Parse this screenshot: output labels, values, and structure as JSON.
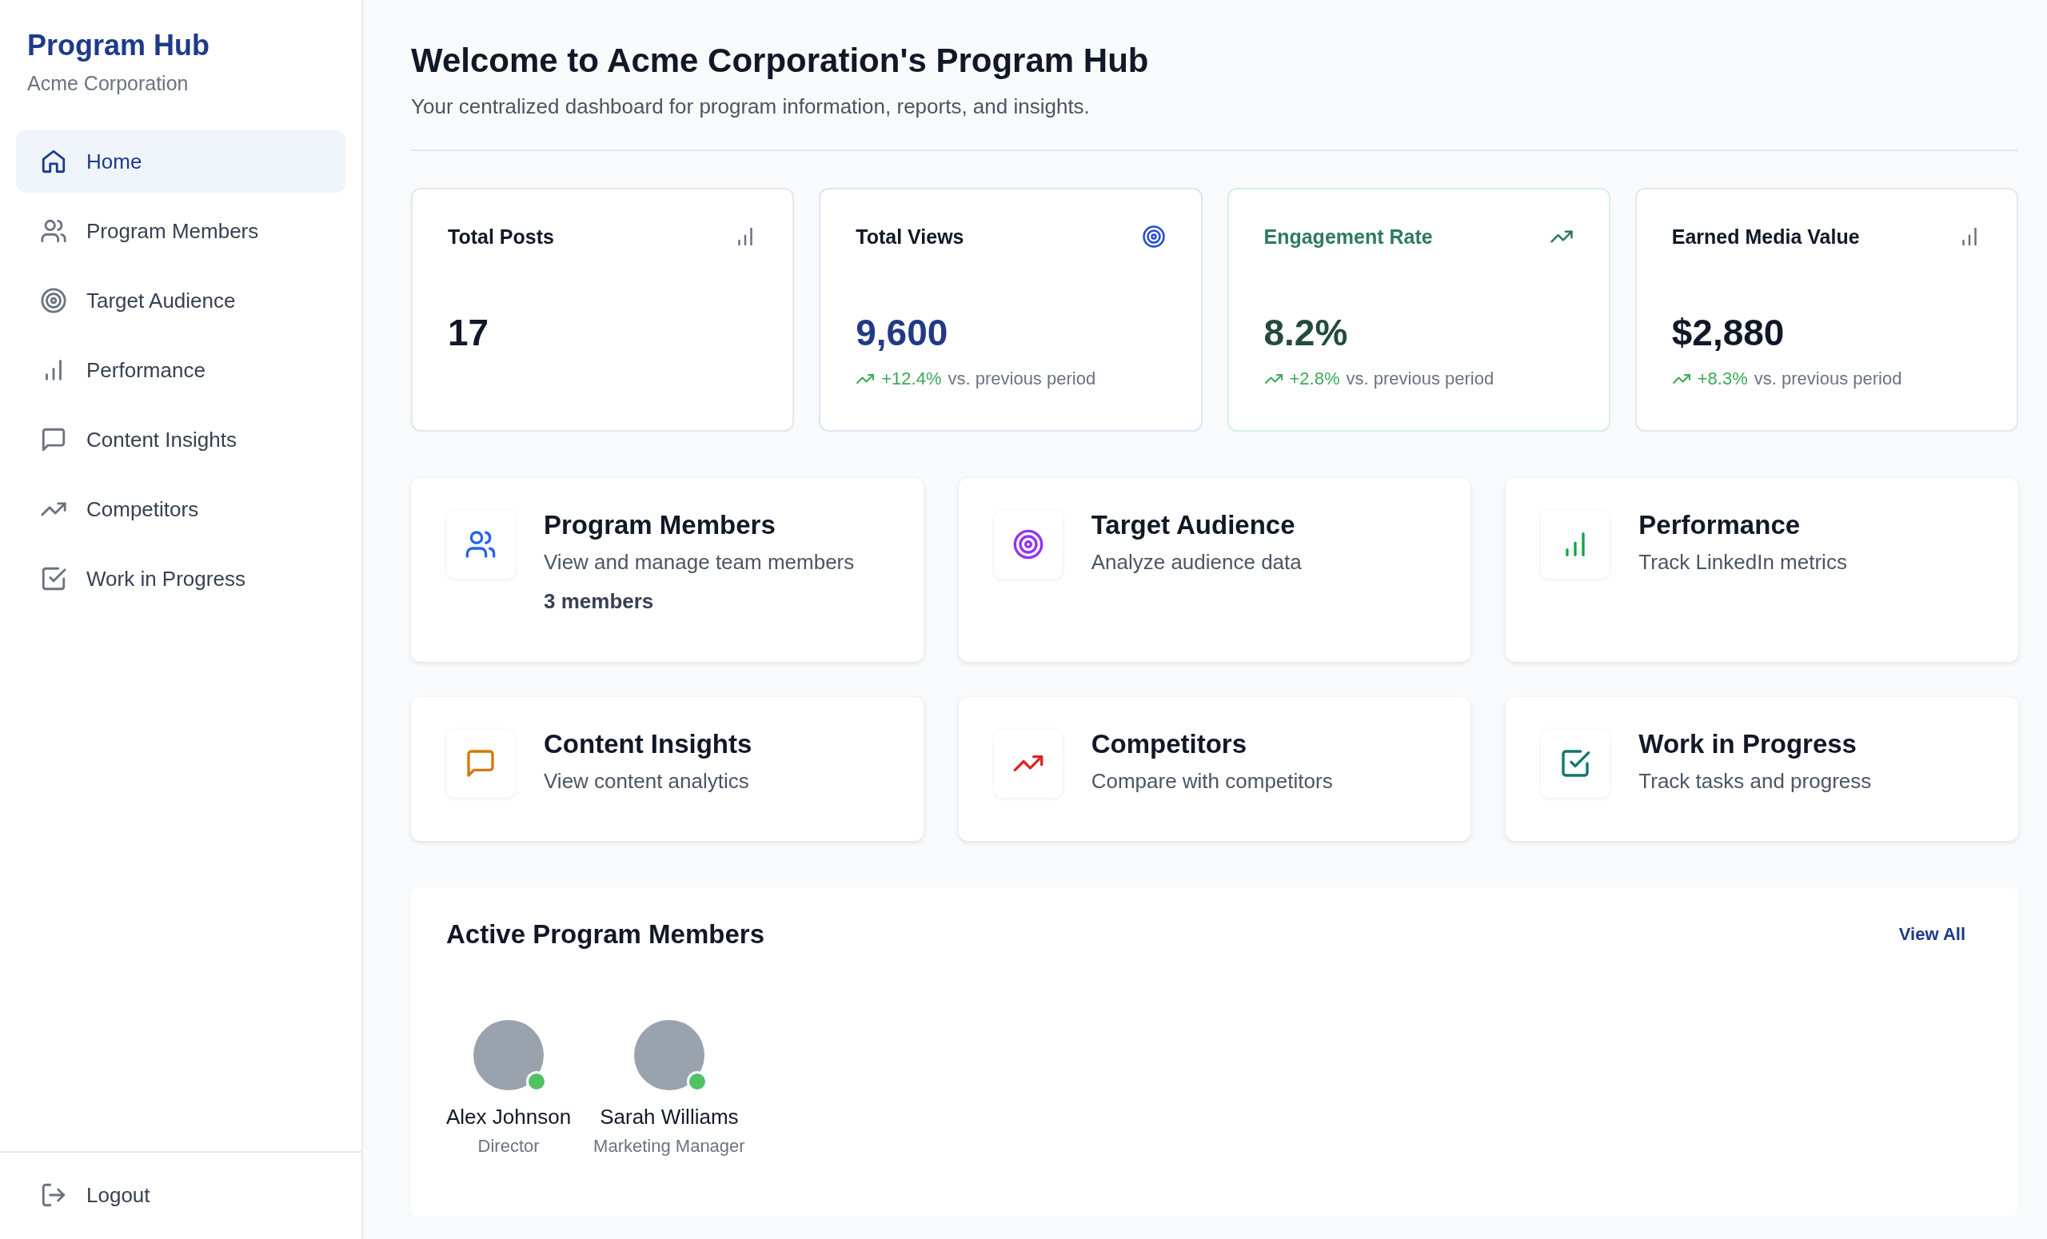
{
  "sidebar": {
    "title": "Program Hub",
    "subtitle": "Acme Corporation",
    "items": [
      {
        "label": "Home",
        "kind": "home",
        "selected": true
      },
      {
        "label": "Program Members",
        "kind": "members",
        "selected": false
      },
      {
        "label": "Target Audience",
        "kind": "target",
        "selected": false
      },
      {
        "label": "Performance",
        "kind": "performance",
        "selected": false
      },
      {
        "label": "Content Insights",
        "kind": "content",
        "selected": false
      },
      {
        "label": "Competitors",
        "kind": "competitors",
        "selected": false
      },
      {
        "label": "Work in Progress",
        "kind": "tasks",
        "selected": false
      }
    ],
    "logout": "Logout"
  },
  "header": {
    "title": "Welcome to Acme Corporation's Program Hub",
    "subtitle": "Your centralized dashboard for program information, reports, and insights."
  },
  "stats": [
    {
      "title": "Total Posts",
      "value": "17",
      "kind": "plain"
    },
    {
      "title": "Total Views",
      "value": "9,600",
      "kind": "primary",
      "change": "+12.4%",
      "change_note": "vs. previous period"
    },
    {
      "title": "Engagement Rate",
      "value": "8.2%",
      "kind": "success",
      "change": "+2.8%",
      "change_note": "vs. previous period"
    },
    {
      "title": "Earned Media Value",
      "value": "$2,880",
      "kind": "plain",
      "change": "+8.3%",
      "change_note": "vs. previous period"
    }
  ],
  "features": [
    {
      "title": "Program Members",
      "description": "View and manage team members",
      "count": "3 members",
      "kind": "members",
      "color": "#2563eb"
    },
    {
      "title": "Target Audience",
      "description": "Analyze audience data",
      "kind": "target",
      "color": "#9333ea"
    },
    {
      "title": "Performance",
      "description": "Track LinkedIn metrics",
      "kind": "performance",
      "color": "#16a34a"
    },
    {
      "title": "Content Insights",
      "description": "View content analytics",
      "kind": "content",
      "color": "#d97706"
    },
    {
      "title": "Competitors",
      "description": "Compare with competitors",
      "kind": "competitors",
      "color": "#dc2626"
    },
    {
      "title": "Work in Progress",
      "description": "Track tasks and progress",
      "kind": "tasks",
      "color": "#0f766e"
    }
  ],
  "members_section": {
    "title": "Active Program Members",
    "link": "View All",
    "members": [
      {
        "name": "Alex Johnson",
        "role": "Director",
        "online": true
      },
      {
        "name": "Sarah Williams",
        "role": "Marketing Manager",
        "online": true
      }
    ]
  }
}
